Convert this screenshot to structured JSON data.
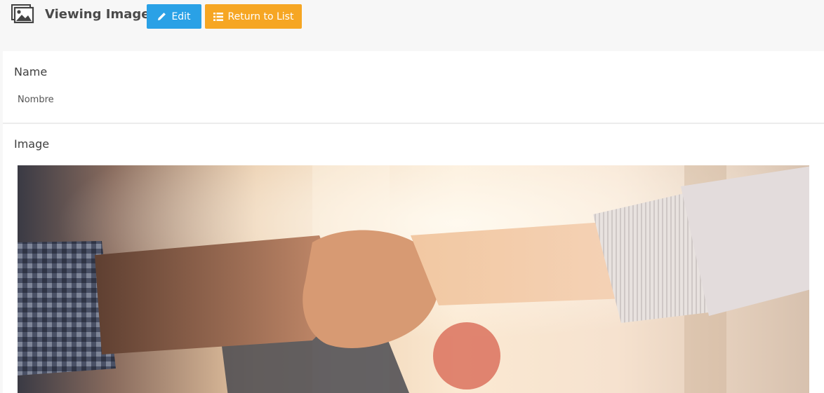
{
  "header": {
    "title": "Viewing Image",
    "icon": "images-icon",
    "edit_label": "Edit",
    "edit_icon": "pencil-icon",
    "return_label": "Return to List",
    "return_icon": "list-icon"
  },
  "fields": {
    "name_label": "Name",
    "name_value": "Nombre",
    "image_label": "Image",
    "image_description": "handshake-photo"
  },
  "colors": {
    "edit_button": "#2aa1e6",
    "return_button": "#f6a623",
    "background": "#f7f7f7"
  }
}
